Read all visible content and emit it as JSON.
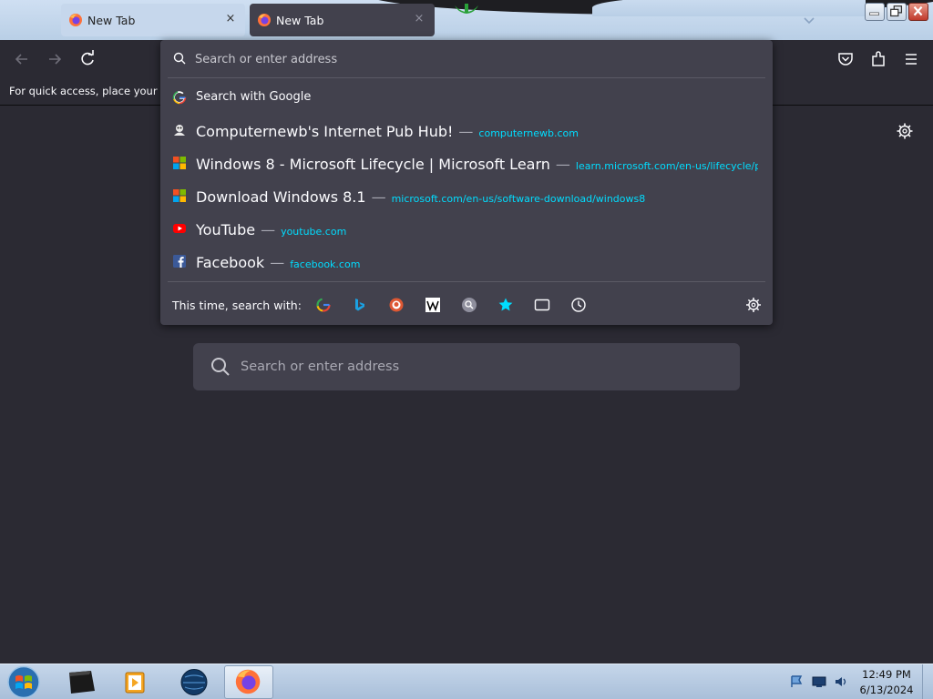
{
  "tabs": [
    {
      "label": "New Tab",
      "close": "×"
    },
    {
      "label": "New Tab",
      "close": "×"
    }
  ],
  "navbar": {
    "icons": [
      "back-arrow-icon",
      "forward-arrow-icon",
      "reload-icon",
      "pocket-icon",
      "extensions-icon",
      "hamburger-menu-icon"
    ]
  },
  "bookmarks_bar": {
    "hint_visible": "For quick access, place your boo"
  },
  "urlbar": {
    "placeholder": "Search or enter address",
    "results": [
      {
        "title": "Search with Google",
        "icon": "google-icon"
      },
      {
        "title": "Computernewb's Internet Pub Hub!",
        "url": "computernewb.com",
        "icon": "site-favicon-icon"
      },
      {
        "title": "Windows 8 - Microsoft Lifecycle | Microsoft Learn",
        "url": "learn.microsoft.com/en-us/lifecycle/products/window",
        "icon": "microsoft-icon"
      },
      {
        "title": "Download Windows 8.1",
        "url": "microsoft.com/en-us/software-download/windows8",
        "icon": "microsoft-icon"
      },
      {
        "title": "YouTube",
        "url": "youtube.com",
        "icon": "youtube-icon"
      },
      {
        "title": "Facebook",
        "url": "facebook.com",
        "icon": "facebook-icon"
      }
    ],
    "separator": "—",
    "one_off_label": "This time, search with:",
    "one_offs": [
      "google-icon",
      "bing-icon",
      "duckduckgo-icon",
      "wikipedia-icon",
      "search-engine-icon",
      "bookmarks-star-icon",
      "tabs-icon",
      "history-clock-icon"
    ]
  },
  "content": {
    "search_placeholder": "Search or enter address"
  },
  "taskbar": {
    "items": [
      "start-orb",
      "terminal-app",
      "media-player-app",
      "globe-browser-app",
      "firefox-app"
    ],
    "time": "12:49 PM",
    "date": "6/13/2024"
  },
  "colors": {
    "panel": "#42414d",
    "page": "#2b2a33",
    "url_link": "#00ddff"
  }
}
